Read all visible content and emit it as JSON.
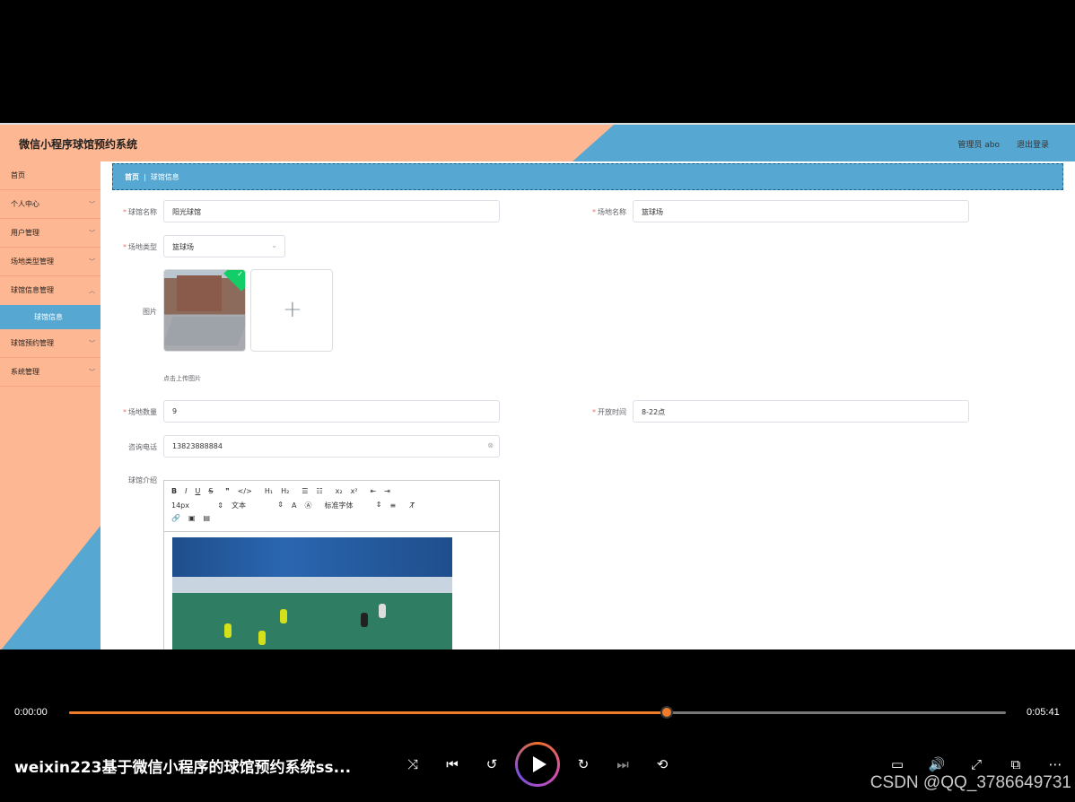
{
  "app": {
    "title": "微信小程序球馆预约系统",
    "admin_label": "管理员 abo",
    "logout_label": "退出登录"
  },
  "sidebar": {
    "items": [
      {
        "label": "首页"
      },
      {
        "label": "个人中心"
      },
      {
        "label": "用户管理"
      },
      {
        "label": "场地类型管理"
      },
      {
        "label": "球馆信息管理"
      },
      {
        "label": "球馆信息"
      },
      {
        "label": "球馆预约管理"
      },
      {
        "label": "系统管理"
      }
    ]
  },
  "breadcrumb": {
    "home": "首页",
    "current": "球馆信息"
  },
  "form": {
    "venue_name": {
      "label": "球馆名称",
      "value": "阳光球馆"
    },
    "field_name": {
      "label": "场地名称",
      "value": "篮球场"
    },
    "field_type": {
      "label": "场地类型",
      "value": "篮球场"
    },
    "image": {
      "label": "图片",
      "hint": "点击上传图片"
    },
    "field_count": {
      "label": "场地数量",
      "value": "9"
    },
    "open_time": {
      "label": "开放时间",
      "value": "8-22点"
    },
    "phone": {
      "label": "咨询电话",
      "value": "13823888884"
    },
    "intro": {
      "label": "球馆介绍"
    }
  },
  "editor": {
    "row1": [
      "B",
      "I",
      "U",
      "S",
      "❞",
      "</>",
      "H₁",
      "H₂",
      "☰",
      "☷",
      "x₂",
      "x²",
      "⇤",
      "⇥"
    ],
    "font_size": "14px",
    "text_type": "文本",
    "font_family": "标准字体",
    "row3": [
      "🔗",
      "▣",
      "▤"
    ]
  },
  "player": {
    "current_time": "0:00:00",
    "duration": "0:05:41",
    "progress": 0.638,
    "title": "weixin223基于微信小程序的球馆预约系统ss...",
    "watermark": "CSDN @QQ_3786649731",
    "accent": "#f07b2a"
  }
}
